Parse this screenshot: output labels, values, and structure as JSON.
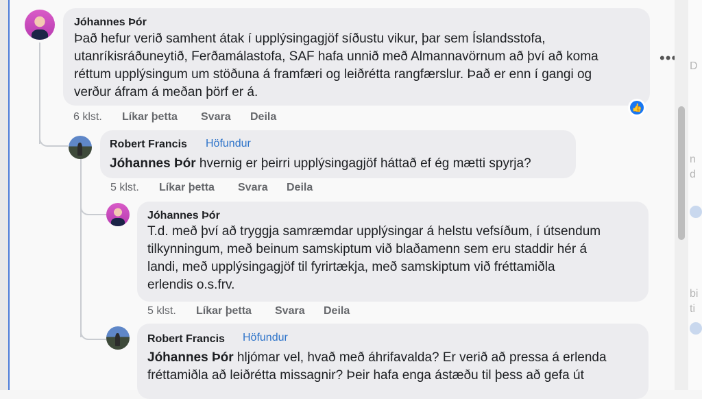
{
  "comments": [
    {
      "author": "Jóhannes Þór",
      "lines": [
        "Það hefur verið samhent átak í upplýsingagjöf síðustu vikur, þar sem Íslandsstofa,",
        "utanríkisráðuneytið, Ferðamálastofa, SAF hafa unnið með Almannavörnum að því að koma",
        "réttum upplýsingum um stöðuna á framfæri og leiðrétta rangfærslur. Það er enn í gangi og",
        "verður áfram á meðan þörf er á."
      ],
      "time": "6 klst.",
      "like": "Líkar þetta",
      "reply": "Svara",
      "share": "Deila"
    },
    {
      "author": "Robert Francis",
      "badge": "Höfundur",
      "mention": "Jóhannes Þór",
      "text": " hvernig er þeirri upplýsingagjöf háttað ef ég mætti spyrja?",
      "time": "5 klst.",
      "like": "Líkar þetta",
      "reply": "Svara",
      "share": "Deila"
    },
    {
      "author": "Jóhannes Þór",
      "lines": [
        "T.d. með því að tryggja samræmdar upplýsingar á helstu vefsíðum, í útsendum",
        "tilkynningum, með beinum samskiptum við blaðamenn sem eru staddir hér á",
        "landi, með upplýsingagjöf til fyrirtækja, með samskiptum við fréttamiðla",
        "erlendis o.s.frv."
      ],
      "time": "5 klst.",
      "like": "Líkar þetta",
      "reply": "Svara",
      "share": "Deila"
    },
    {
      "author": "Robert Francis",
      "badge": "Höfundur",
      "mention": "Jóhannes Þór",
      "line1_rest": " hljómar vel, hvað með áhrifavalda? Er verið að pressa á erlenda",
      "line2": "fréttamiðla að leiðrétta missagnir? Þeir hafa enga ástæðu til þess að gefa út"
    }
  ],
  "more_icon": "•••",
  "like_reaction_icon": "👍",
  "right_strip": [
    "D",
    "n",
    "d",
    "bi",
    "ti"
  ],
  "colors": {
    "badge": "#2d73c9",
    "bubble": "#ececef",
    "meta": "#65676b",
    "like": "#1877f2"
  }
}
